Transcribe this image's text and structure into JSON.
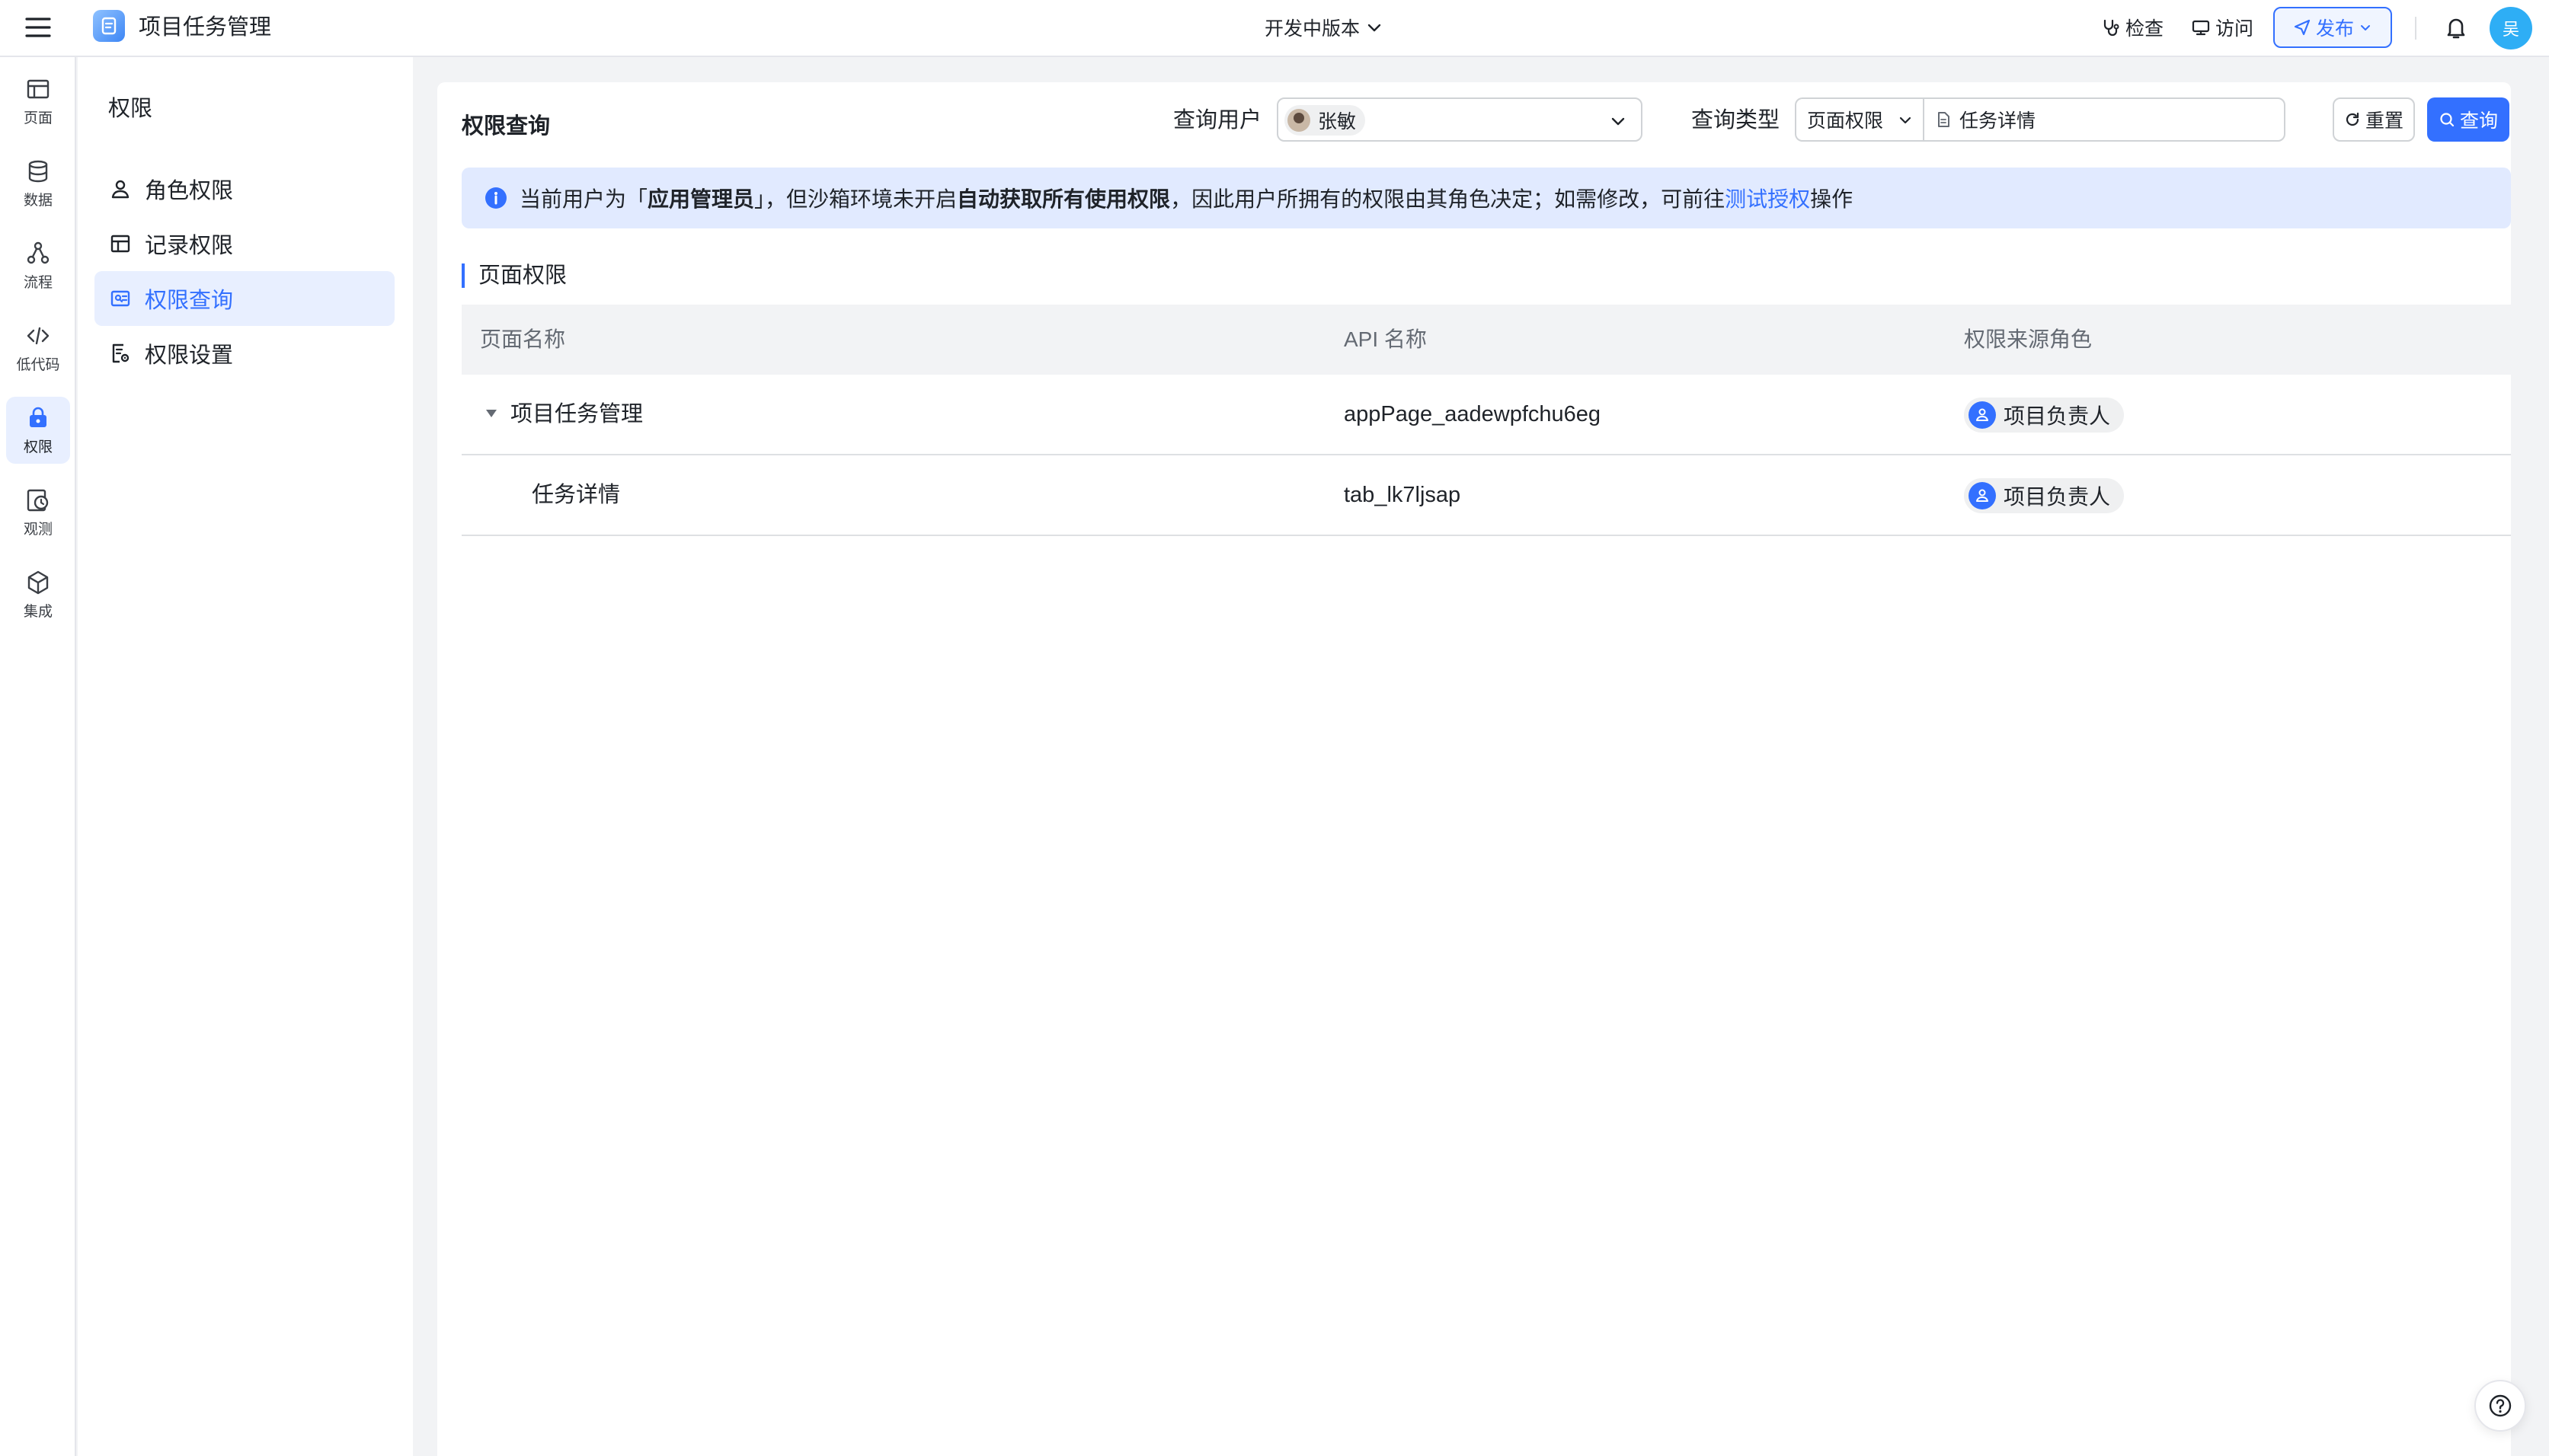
{
  "header": {
    "app_title": "项目任务管理",
    "version_label": "开发中版本",
    "check_label": "检查",
    "visit_label": "访问",
    "publish_label": "发布",
    "user_avatar_text": "吴"
  },
  "rail": {
    "items": [
      {
        "label": "页面",
        "icon": "page-icon"
      },
      {
        "label": "数据",
        "icon": "database-icon"
      },
      {
        "label": "流程",
        "icon": "flow-icon"
      },
      {
        "label": "低代码",
        "icon": "code-icon"
      },
      {
        "label": "权限",
        "icon": "lock-icon",
        "active": true
      },
      {
        "label": "观测",
        "icon": "observe-icon"
      },
      {
        "label": "集成",
        "icon": "cube-icon"
      }
    ]
  },
  "subnav": {
    "title": "权限",
    "items": [
      {
        "label": "角色权限",
        "icon": "user-icon"
      },
      {
        "label": "记录权限",
        "icon": "table-icon"
      },
      {
        "label": "权限查询",
        "icon": "query-icon",
        "active": true
      },
      {
        "label": "权限设置",
        "icon": "settings-doc-icon"
      }
    ]
  },
  "query": {
    "title": "权限查询",
    "user_label": "查询用户",
    "user_value": "张敏",
    "type_label": "查询类型",
    "type_value": "页面权限",
    "page_value": "任务详情",
    "reset_label": "重置",
    "query_label": "查询"
  },
  "notice": {
    "part1": "当前用户为「",
    "role": "应用管理员",
    "part2": "」，但沙箱环境未开启",
    "feature": "自动获取所有使用权限",
    "part3": "，因此用户所拥有的权限由其角色决定；如需修改，可前往",
    "link": "测试授权",
    "part4": "操作"
  },
  "section": {
    "title": "页面权限"
  },
  "table": {
    "columns": [
      "页面名称",
      "API 名称",
      "权限来源角色"
    ],
    "rows": [
      {
        "name": "项目任务管理",
        "api": "appPage_aadewpfchu6eg",
        "role": "项目负责人",
        "expanded": true
      },
      {
        "name": "任务详情",
        "api": "tab_lk7ljsap",
        "role": "项目负责人"
      }
    ]
  },
  "colors": {
    "accent": "#3370ff",
    "notice_bg": "#e1eaff",
    "active_bg": "#e8efff"
  }
}
